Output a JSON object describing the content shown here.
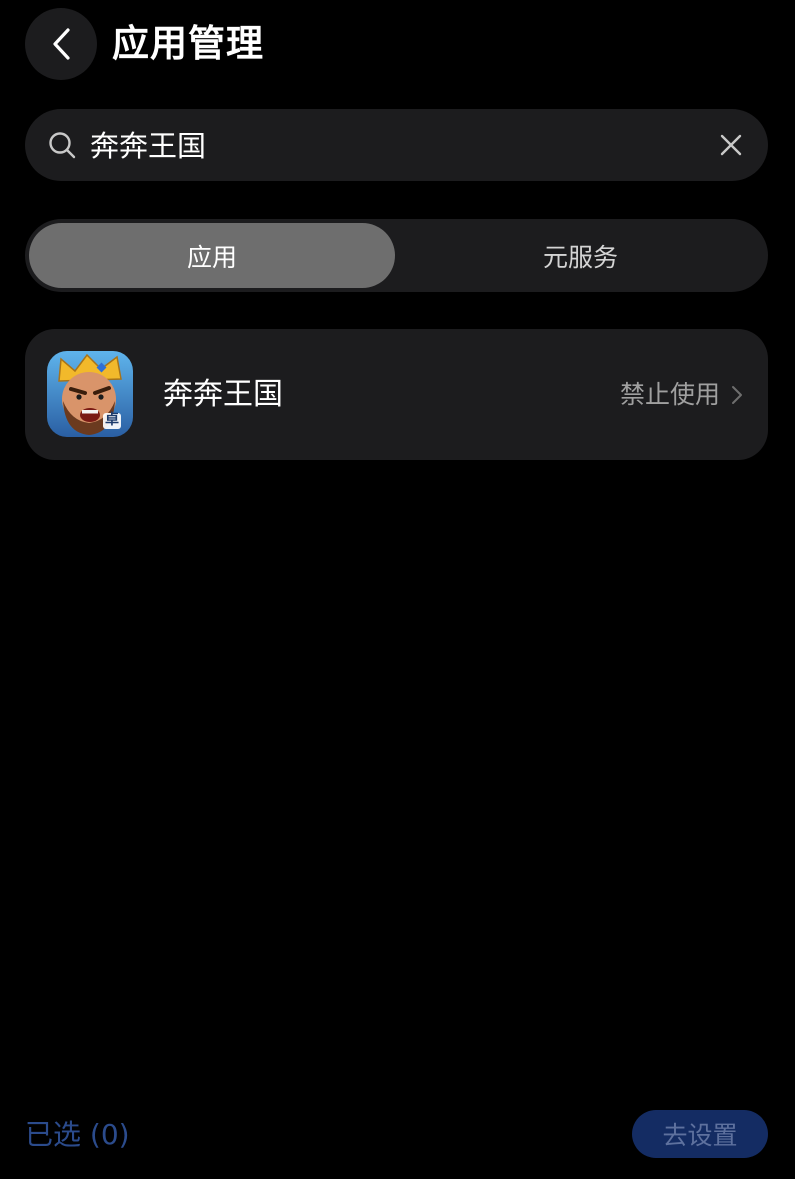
{
  "header": {
    "title": "应用管理",
    "back_icon": "chevron-left-icon"
  },
  "search": {
    "value": "奔奔王国",
    "search_icon": "search-icon",
    "clear_icon": "close-icon"
  },
  "tabs": [
    {
      "label": "应用",
      "active": true
    },
    {
      "label": "元服务",
      "active": false
    }
  ],
  "results": [
    {
      "name": "奔奔王国",
      "status": "禁止使用",
      "icon": "royal-kingdom-app-icon",
      "badge": "卓"
    }
  ],
  "footer": {
    "selected_label": "已选 (0)",
    "action_label": "去设置"
  },
  "colors": {
    "background": "#000000",
    "card": "#1c1c1e",
    "active_tab": "#6e6e6e",
    "accent_text": "#2b4b8c",
    "button_bg": "#142c63"
  }
}
